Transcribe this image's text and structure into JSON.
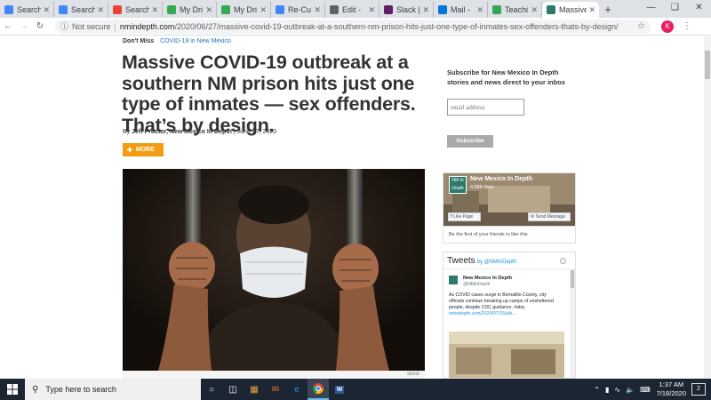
{
  "browser": {
    "tabs": [
      {
        "title": "Search",
        "color": "#4285f4",
        "active": false
      },
      {
        "title": "Search",
        "color": "#4285f4",
        "active": false
      },
      {
        "title": "Search",
        "color": "#ea4335",
        "active": false
      },
      {
        "title": "My Dri",
        "color": "#34a853",
        "active": false
      },
      {
        "title": "My Dri",
        "color": "#34a853",
        "active": false
      },
      {
        "title": "Re-Cu",
        "color": "#4285f4",
        "active": false
      },
      {
        "title": "Edit -",
        "color": "#5f6368",
        "active": false
      },
      {
        "title": "Slack |",
        "color": "#611f69",
        "active": false
      },
      {
        "title": "Mail -",
        "color": "#0078d4",
        "active": false
      },
      {
        "title": "Teachi",
        "color": "#34a853",
        "active": false
      },
      {
        "title": "Massive",
        "color": "#2c7a6e",
        "active": true
      }
    ],
    "new_tab": "+",
    "security": "Not secure",
    "url_domain": "nmindepth.com",
    "url_path": "/2020/06/27/massive-covid-19-outbreak-at-a-southern-nm-prison-hits-just-one-type-of-inmates-sex-offenders-thats-by-design/",
    "profile_initial": "K"
  },
  "article": {
    "dont_miss_label": "Don't Miss",
    "dont_miss_link": "COVID-19 in New Mexico",
    "headline": "Massive COVID-19 outbreak at a southern NM prison hits just one type of inmates — sex offenders. That’s by design.",
    "by": "By",
    "author": "Jeff Proctor, New Mexico In Depth",
    "date": "| June 27, 2020",
    "more_label": "MORE",
    "image_credit": "stock"
  },
  "sidebar": {
    "subscribe_text": "Subscribe for New Mexico In Depth stories and news direct to your inbox",
    "email_placeholder": "email address",
    "subscribe_button": "Subscribe",
    "facebook": {
      "page_name": "New Mexico In Depth",
      "likes": "4,888 likes",
      "logo_text": "NM In Depth",
      "like_button": "Like Page",
      "send_button": "Send Message",
      "friends_text": "Be the first of your friends to like this"
    },
    "twitter": {
      "title": "Tweets",
      "by": "by",
      "handle": "@NMInDepth",
      "tweet_name": "New Mexico In Depth",
      "tweet_handle": "@NMInDepth",
      "tweet_text": "As COVID cases surge in Bernalillo County, city officials continue breaking up camps of unsheltered people, despite CDC guidance. #abq",
      "tweet_link": "nmindepth.com/2020/07/15/alb..."
    }
  },
  "taskbar": {
    "search_placeholder": "Type here to search",
    "time": "1:37 AM",
    "date": "7/18/2020",
    "notification_count": "2"
  }
}
